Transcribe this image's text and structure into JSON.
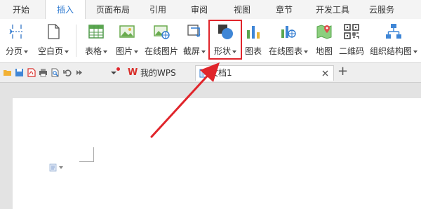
{
  "tabs": [
    "开始",
    "插入",
    "页面布局",
    "引用",
    "审阅",
    "视图",
    "章节",
    "开发工具",
    "云服务"
  ],
  "active_tab": "插入",
  "ribbon": {
    "page_break": "分页",
    "blank_page": "空白页",
    "table": "表格",
    "picture": "图片",
    "online_picture": "在线图片",
    "screenshot": "截屏",
    "shape": "形状",
    "chart": "图表",
    "online_chart": "在线图表",
    "map": "地图",
    "qrcode": "二维码",
    "org_chart": "组织结构图"
  },
  "doc_tabs": {
    "home": "我的WPS",
    "document": "文档1",
    "new_tab_symbol": "+"
  },
  "colors": {
    "accent": "#2e7ad1",
    "highlight": "#e0252b",
    "wps_red": "#d9302b"
  }
}
